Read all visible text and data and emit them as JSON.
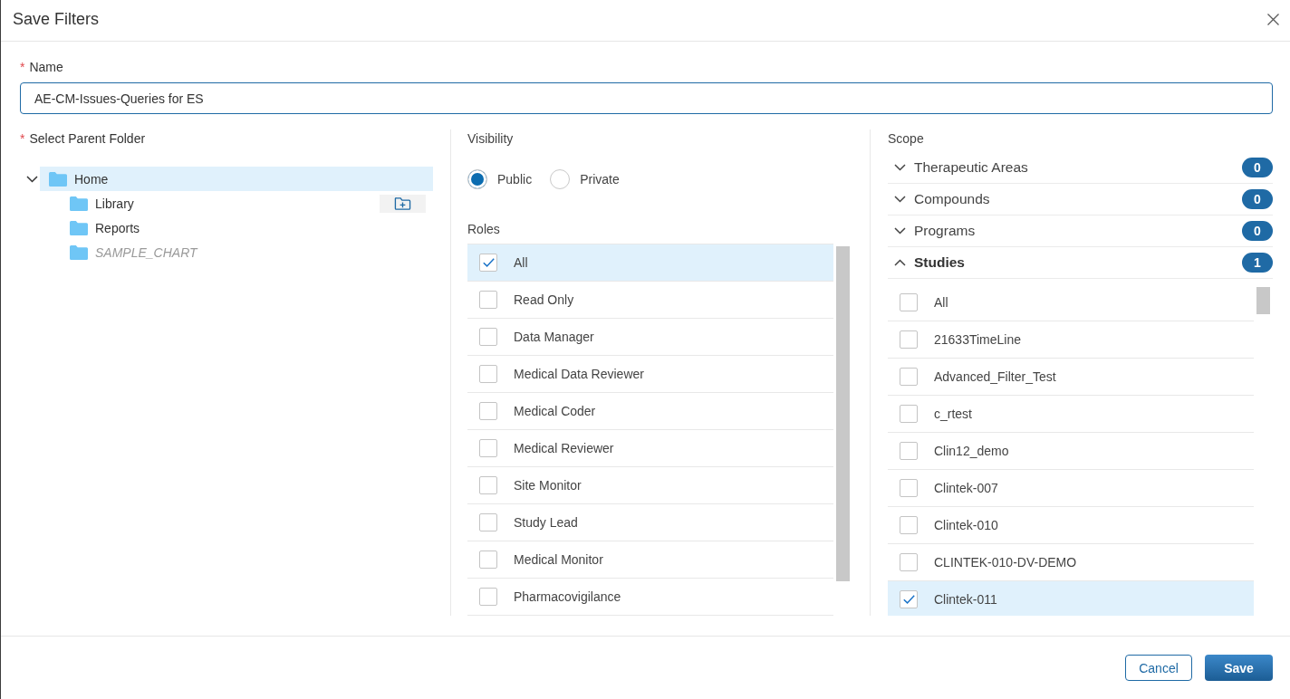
{
  "dialog": {
    "title": "Save Filters"
  },
  "name_field": {
    "required_mark": "*",
    "label": "Name",
    "value": "AE-CM-Issues-Queries for ES"
  },
  "parent_folder": {
    "required_mark": "*",
    "label": "Select Parent Folder",
    "tree": [
      {
        "label": "Home",
        "expanded": true,
        "selected": true,
        "disabled": false,
        "hovered": false,
        "children": [
          {
            "label": "Library",
            "selected": false,
            "disabled": false,
            "hovered": true
          },
          {
            "label": "Reports",
            "selected": false,
            "disabled": false,
            "hovered": false
          },
          {
            "label": "SAMPLE_CHART",
            "selected": false,
            "disabled": true,
            "hovered": false
          }
        ]
      }
    ]
  },
  "visibility": {
    "label": "Visibility",
    "options": [
      {
        "label": "Public",
        "selected": true
      },
      {
        "label": "Private",
        "selected": false
      }
    ]
  },
  "roles": {
    "label": "Roles",
    "items": [
      {
        "label": "All",
        "checked": true
      },
      {
        "label": "Read Only",
        "checked": false
      },
      {
        "label": "Data Manager",
        "checked": false
      },
      {
        "label": "Medical Data Reviewer",
        "checked": false
      },
      {
        "label": "Medical Coder",
        "checked": false
      },
      {
        "label": "Medical Reviewer",
        "checked": false
      },
      {
        "label": "Site Monitor",
        "checked": false
      },
      {
        "label": "Study Lead",
        "checked": false
      },
      {
        "label": "Medical Monitor",
        "checked": false
      },
      {
        "label": "Pharmacovigilance",
        "checked": false
      }
    ]
  },
  "scope": {
    "label": "Scope",
    "groups": [
      {
        "label": "Therapeutic Areas",
        "count": "0",
        "expanded": false
      },
      {
        "label": "Compounds",
        "count": "0",
        "expanded": false
      },
      {
        "label": "Programs",
        "count": "0",
        "expanded": false
      },
      {
        "label": "Studies",
        "count": "1",
        "expanded": true,
        "items": [
          {
            "label": "All",
            "checked": false
          },
          {
            "label": "21633TimeLine",
            "checked": false
          },
          {
            "label": "Advanced_Filter_Test",
            "checked": false
          },
          {
            "label": "c_rtest",
            "checked": false
          },
          {
            "label": "Clin12_demo",
            "checked": false
          },
          {
            "label": "Clintek-007",
            "checked": false
          },
          {
            "label": "Clintek-010",
            "checked": false
          },
          {
            "label": "CLINTEK-010-DV-DEMO",
            "checked": false
          },
          {
            "label": "Clintek-011",
            "checked": true
          }
        ]
      }
    ]
  },
  "footer": {
    "buttons": [
      {
        "label": "Cancel",
        "kind": "secondary"
      },
      {
        "label": "Save",
        "kind": "primary"
      }
    ]
  }
}
